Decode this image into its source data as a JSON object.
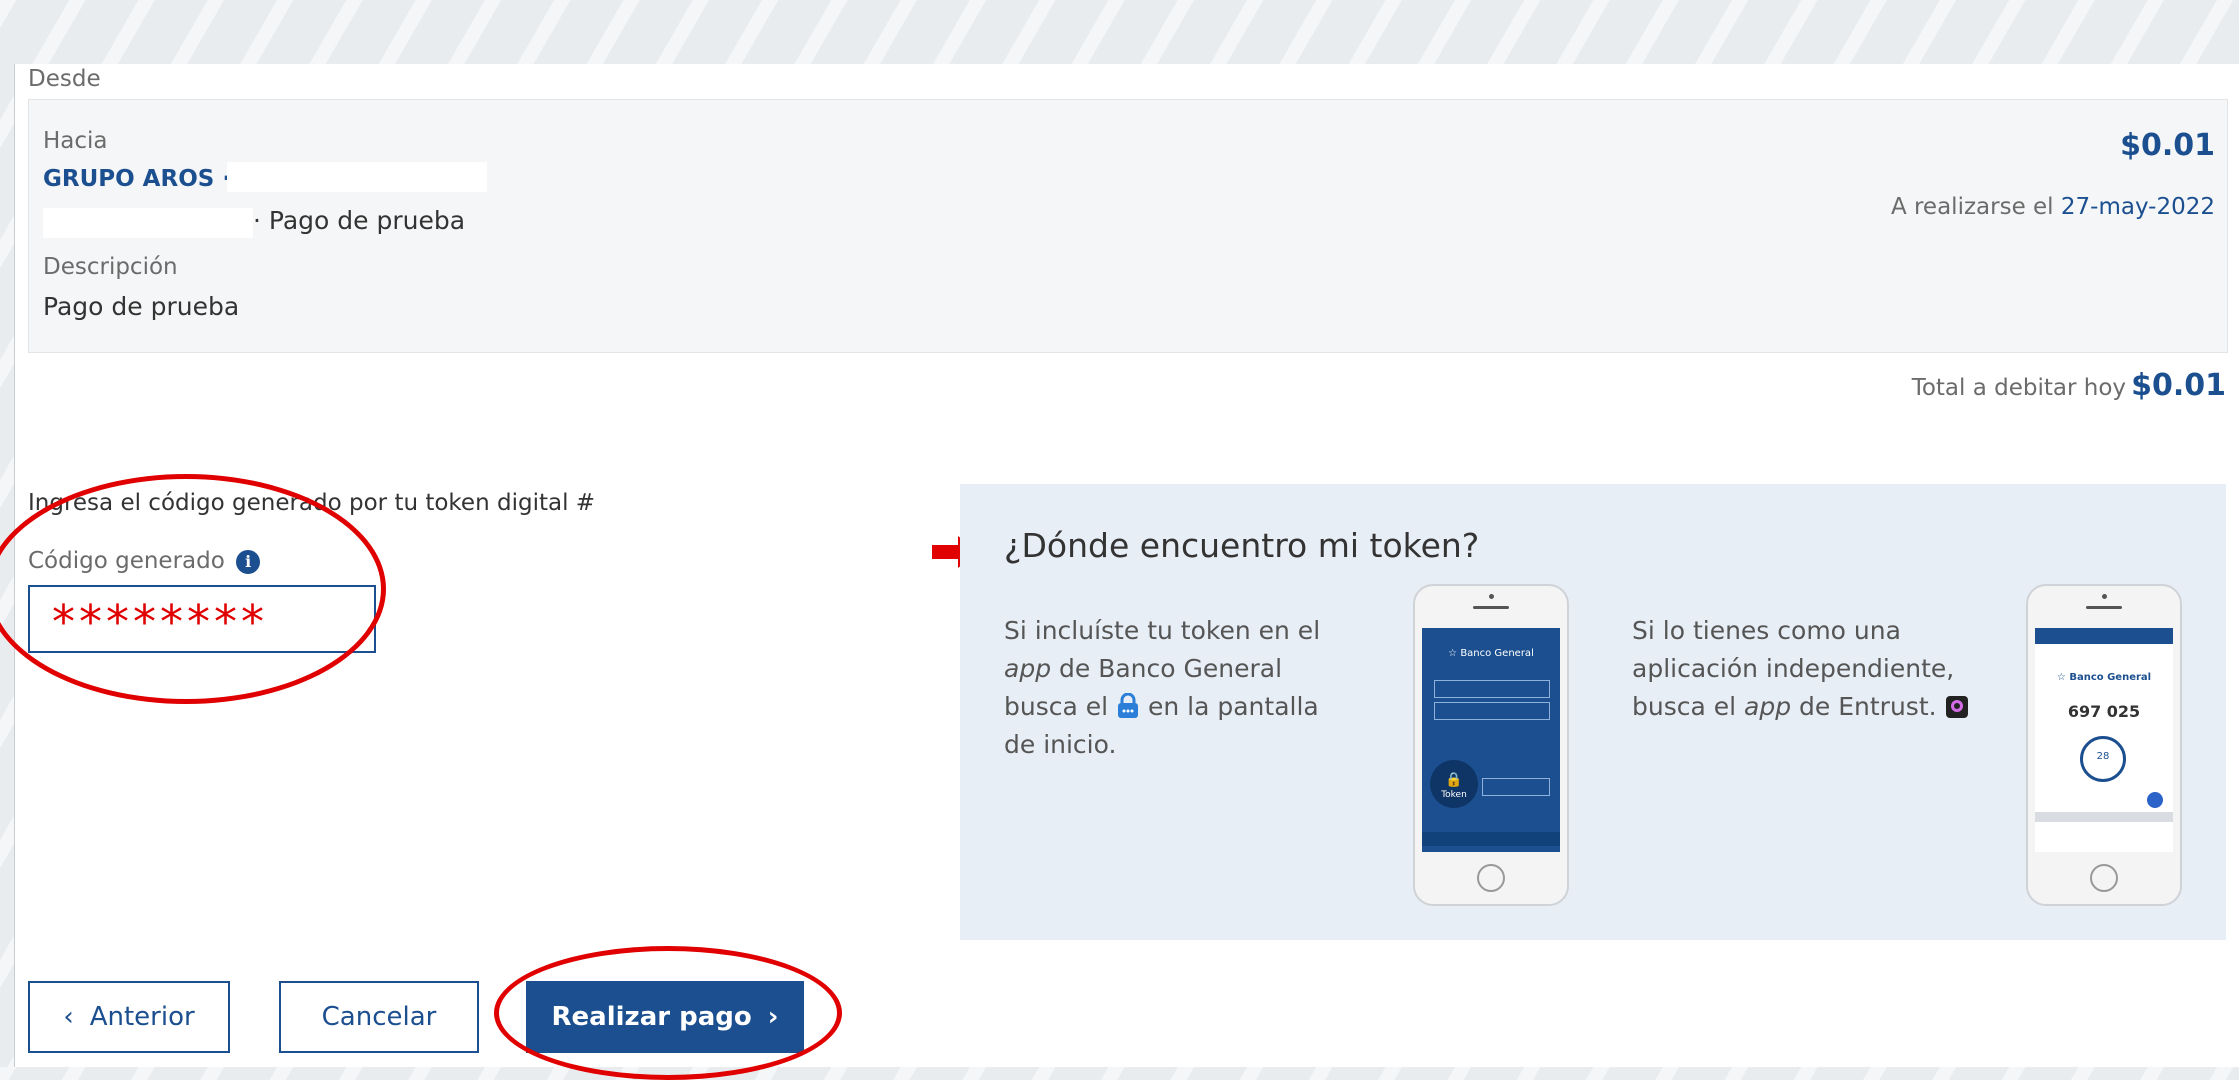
{
  "from": {
    "label": "Desde"
  },
  "summary": {
    "to_label": "Hacia",
    "recipient": "GRUPO AROS ·",
    "reference_suffix": "· Pago de prueba",
    "description_label": "Descripción",
    "description_value": "Pago de prueba",
    "amount": "$0.01",
    "schedule_prefix": "A realizarse el",
    "schedule_date": "27-may-2022"
  },
  "total": {
    "label": "Total a debitar hoy",
    "amount": "$0.01"
  },
  "token": {
    "instruction": "Ingresa el código generado por tu token digital #",
    "field_label": "Código generado",
    "field_value": "********"
  },
  "help": {
    "title": "¿Dónde encuentro mi token?",
    "left_text_1": "Si incluíste tu token en el",
    "left_text_2_italic": "app",
    "left_text_2_rest": "de Banco General",
    "left_text_3a": "busca el",
    "left_text_3b": "en la pantalla",
    "left_text_4": "de inicio.",
    "right_text_1": "Si lo tienes como una",
    "right_text_2": "aplicación independiente,",
    "right_text_3a": "busca el",
    "right_text_3_italic": "app",
    "right_text_3b": "de Entrust.",
    "phone1": {
      "brand": "Banco General",
      "token_label": "Token"
    },
    "phone2": {
      "brand": "Banco General",
      "code": "697 025",
      "timer": "28"
    }
  },
  "actions": {
    "prev_label": "Anterior",
    "cancel_label": "Cancelar",
    "submit_label": "Realizar pago"
  },
  "colors": {
    "accent": "#1b4f8f",
    "annotation": "#e00000",
    "panel": "#e8eef5"
  }
}
